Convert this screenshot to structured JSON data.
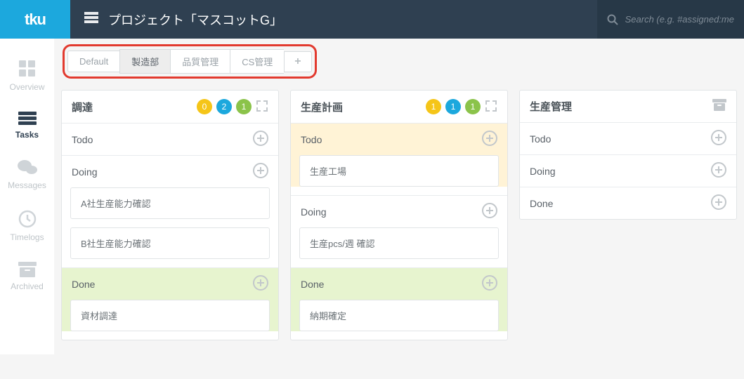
{
  "header": {
    "logo": "tku",
    "project_title": "プロジェクト「マスコットG」"
  },
  "search": {
    "placeholder": "Search (e.g. #assigned:me"
  },
  "sidebar": {
    "items": [
      {
        "label": "Overview"
      },
      {
        "label": "Tasks"
      },
      {
        "label": "Messages"
      },
      {
        "label": "Timelogs"
      },
      {
        "label": "Archived"
      }
    ]
  },
  "tabs": [
    {
      "label": "Default"
    },
    {
      "label": "製造部"
    },
    {
      "label": "品質管理"
    },
    {
      "label": "CS管理"
    }
  ],
  "boards": [
    {
      "title": "調達",
      "badges": [
        {
          "color": "yellow",
          "n": "0"
        },
        {
          "color": "blue",
          "n": "2"
        },
        {
          "color": "green",
          "n": "1"
        }
      ],
      "show_expand": true,
      "stages": [
        {
          "name": "Todo",
          "hl": "",
          "cards": []
        },
        {
          "name": "Doing",
          "hl": "",
          "cards": [
            "A社生産能力確認",
            "B社生産能力確認"
          ]
        },
        {
          "name": "Done",
          "hl": "done",
          "cards": [
            "資材調達"
          ]
        }
      ]
    },
    {
      "title": "生産計画",
      "badges": [
        {
          "color": "yellow",
          "n": "1"
        },
        {
          "color": "blue",
          "n": "1"
        },
        {
          "color": "green",
          "n": "1"
        }
      ],
      "show_expand": true,
      "stages": [
        {
          "name": "Todo",
          "hl": "todo-hl",
          "cards": [
            "生産工場"
          ]
        },
        {
          "name": "Doing",
          "hl": "",
          "cards": [
            "生産pcs/週  確認"
          ]
        },
        {
          "name": "Done",
          "hl": "done",
          "cards": [
            "納期確定"
          ]
        }
      ]
    },
    {
      "title": "生産管理",
      "badges": [],
      "show_expand": false,
      "stages": [
        {
          "name": "Todo",
          "hl": "",
          "cards": []
        },
        {
          "name": "Doing",
          "hl": "",
          "cards": []
        },
        {
          "name": "Done",
          "hl": "",
          "cards": []
        }
      ]
    }
  ]
}
